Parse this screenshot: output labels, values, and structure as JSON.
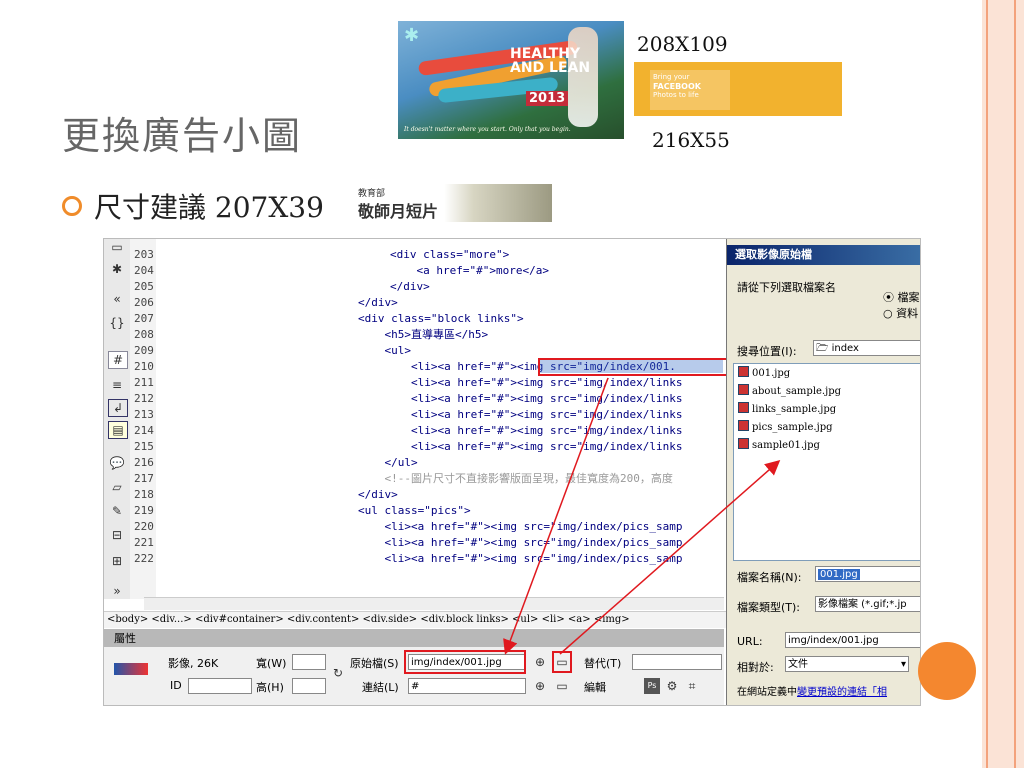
{
  "slide": {
    "title": "更換廣告小圖",
    "bullet": "尺寸建議 207X39",
    "dim_top": "208X109",
    "dim_bottom": "216X55"
  },
  "ads": {
    "healthy": {
      "line1": "HEALTHY",
      "line2": "AND LEAN",
      "year": "2013",
      "tagline": "It doesn't matter where you start. Only that you begin."
    },
    "facebook": {
      "text1": "Bring your",
      "text2": "FACEBOOK",
      "text3": "Photos to life"
    },
    "teacher": {
      "small": "教育部",
      "big": "敬師月短片"
    }
  },
  "editor": {
    "line_numbers": [
      "203",
      "204",
      "205",
      "206",
      "207",
      "208",
      "209",
      "210",
      "211",
      "212",
      "213",
      "214",
      "215",
      "216",
      "217",
      "218",
      "219",
      "220",
      "221",
      "222"
    ],
    "code_lines": [
      "<div class=\"more\">",
      "    <a href=\"#\">more</a>",
      "</div>",
      "</div>",
      "<div class=\"block links\">",
      "    <h5>直導專區</h5>",
      "    <ul>",
      "        <li><a href=\"#\"><img src=\"img/index/001.",
      "        <li><a href=\"#\"><img src=\"img/index/links",
      "        <li><a href=\"#\"><img src=\"img/index/links",
      "        <li><a href=\"#\"><img src=\"img/index/links",
      "        <li><a href=\"#\"><img src=\"img/index/links",
      "        <li><a href=\"#\"><img src=\"img/index/links",
      "    </ul>",
      "    <!--圖片尺寸不直接影響版面呈現，最佳寬度為200，高度",
      "</div>",
      "<ul class=\"pics\">",
      "    <li><a href=\"#\"><img src=\"img/index/pics_samp",
      "    <li><a href=\"#\"><img src=\"img/index/pics_samp",
      "    <li><a href=\"#\"><img src=\"img/index/pics_samp"
    ],
    "tag_path": "<body> <div...> <div#container> <div.content> <div.side> <div.block links> <ul> <li> <a> <img>"
  },
  "properties": {
    "header": "屬性",
    "image_info": "影像, 26K",
    "width_label": "寬(W)",
    "height_label": "高(H)",
    "src_label": "原始檔(S)",
    "src_value": "img/index/001.jpg",
    "link_label": "連結(L)",
    "link_value": "#",
    "alt_label": "替代(T)",
    "edit_label": "編輯",
    "id_label": "ID"
  },
  "dialog": {
    "title": "選取影像原始檔",
    "prompt": "請從下列選取檔案名",
    "radio1": "檔案",
    "radio2": "資料",
    "lookin_label": "搜尋位置(I):",
    "lookin_value": "index",
    "files": [
      "001.jpg",
      "about_sample.jpg",
      "links_sample.jpg",
      "pics_sample.jpg",
      "sample01.jpg"
    ],
    "filename_label": "檔案名稱(N):",
    "filename_value": "001.jpg",
    "filetype_label": "檔案類型(T):",
    "filetype_value": "影像檔案 (*.gif;*.jp",
    "url_label": "URL:",
    "url_value": "img/index/001.jpg",
    "relative_label": "相對於:",
    "relative_value": "文件",
    "footer": "在網站定義中",
    "footer_link": "變更預設的連結「相"
  }
}
